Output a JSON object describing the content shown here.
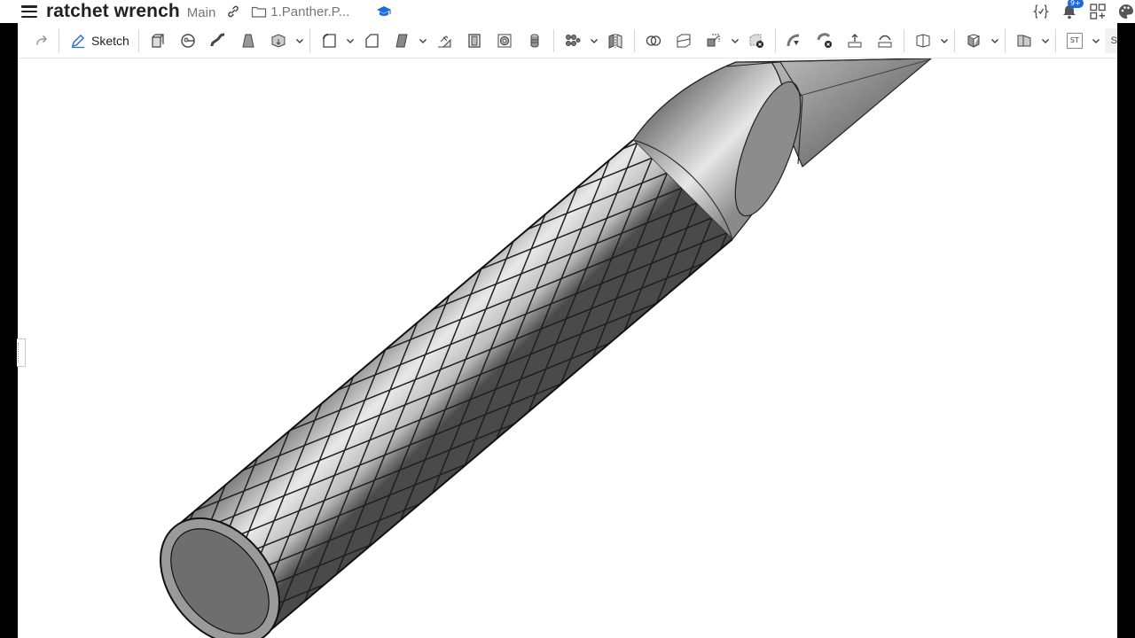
{
  "header": {
    "doc_title": "ratchet wrench",
    "branch": "Main",
    "folder": "1.Panther.P...",
    "notifications_badge": "9+"
  },
  "toolbar": {
    "sketch_label": "Sketch",
    "st_label": "ST",
    "overflow_label": "S"
  },
  "icons": {
    "menu": "hamburger-icon",
    "link": "link-icon",
    "folder": "folder-icon",
    "education": "graduation-cap-icon",
    "variables": "variable-icon",
    "notifications": "bell-icon",
    "apps": "apps-grid-icon",
    "appearance": "palette-icon"
  },
  "colors": {
    "accent_blue": "#1a6ae0",
    "part_gray": "#8a8a8a",
    "edge_black": "#1a1a1a"
  }
}
